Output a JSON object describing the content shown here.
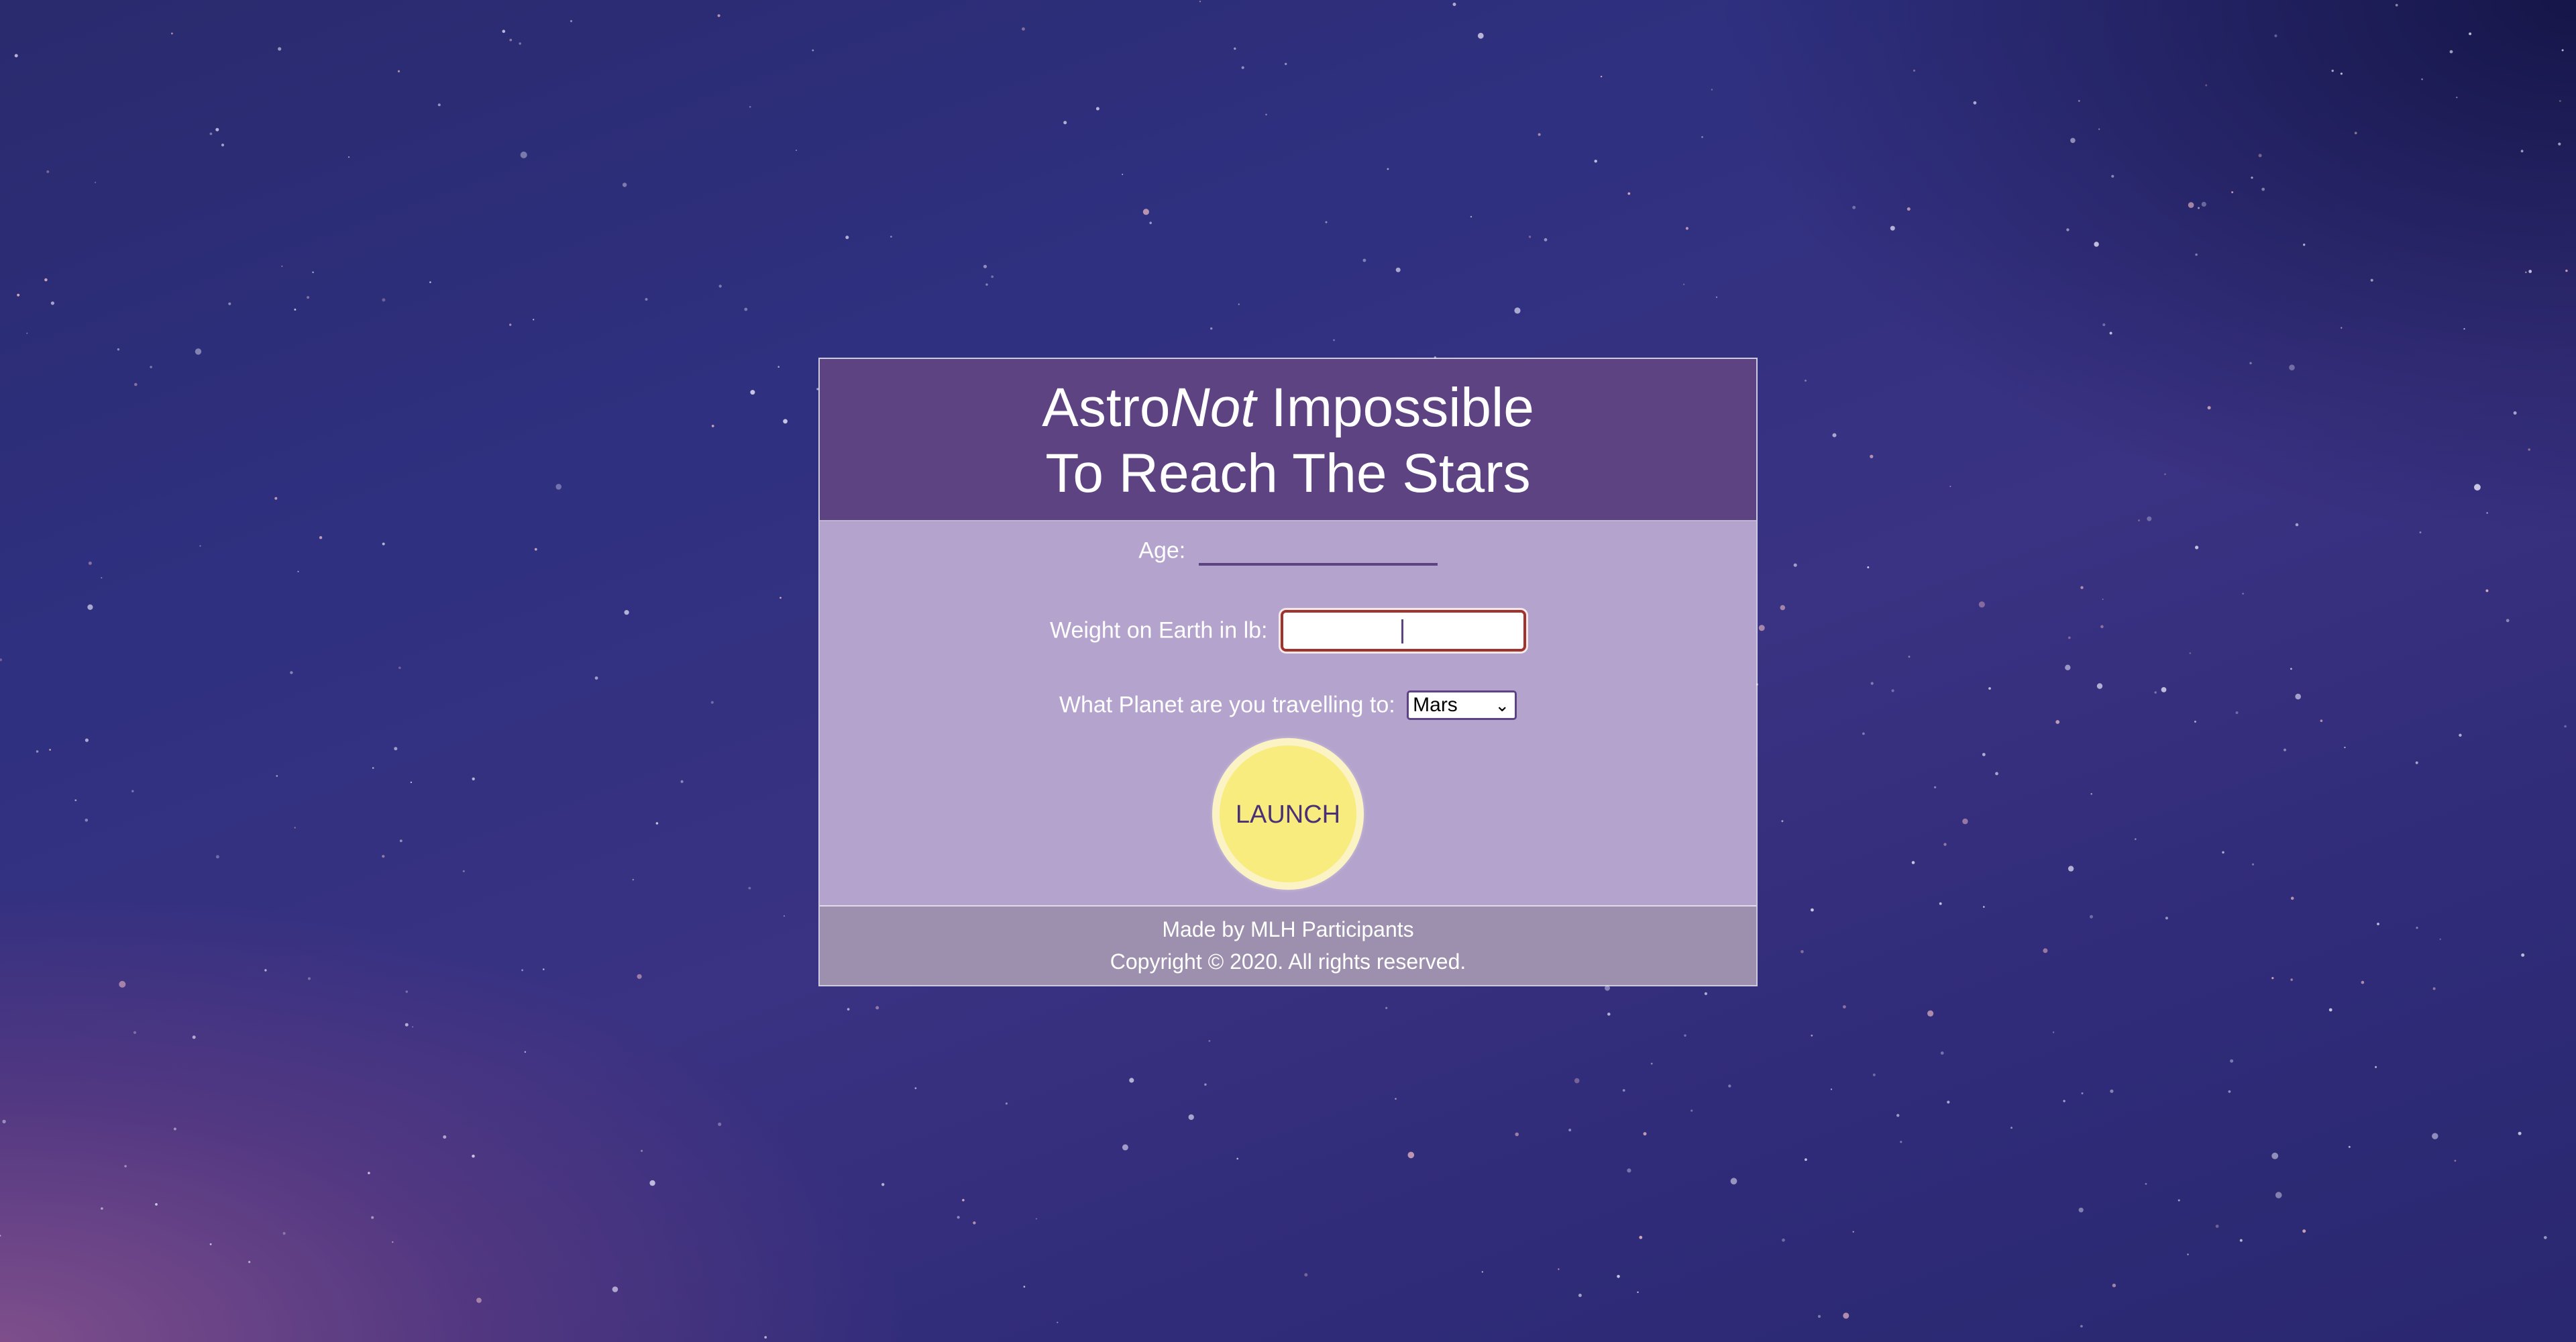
{
  "header": {
    "title_prefix": "Astro",
    "title_emphasis": "Not",
    "title_suffix": " Impossible",
    "subtitle": "To Reach The Stars"
  },
  "form": {
    "age_label": "Age:",
    "age_value": "",
    "weight_label": "Weight on Earth in lb:",
    "weight_value": "",
    "planet_label": "What Planet are you travelling to:",
    "planet_selected": "Mars",
    "launch_label": "LAUNCH"
  },
  "footer": {
    "credit": "Made by MLH Participants",
    "copyright": "Copyright © 2020. All rights reserved."
  },
  "colors": {
    "header_bg": "#5e4382",
    "body_bg": "#b4a3cc",
    "footer_bg": "#9d90ae",
    "launch_button": "#f8ec7e",
    "focus_border": "#a0332c"
  },
  "icons": {
    "select_chevron": "chevron-down-icon"
  }
}
